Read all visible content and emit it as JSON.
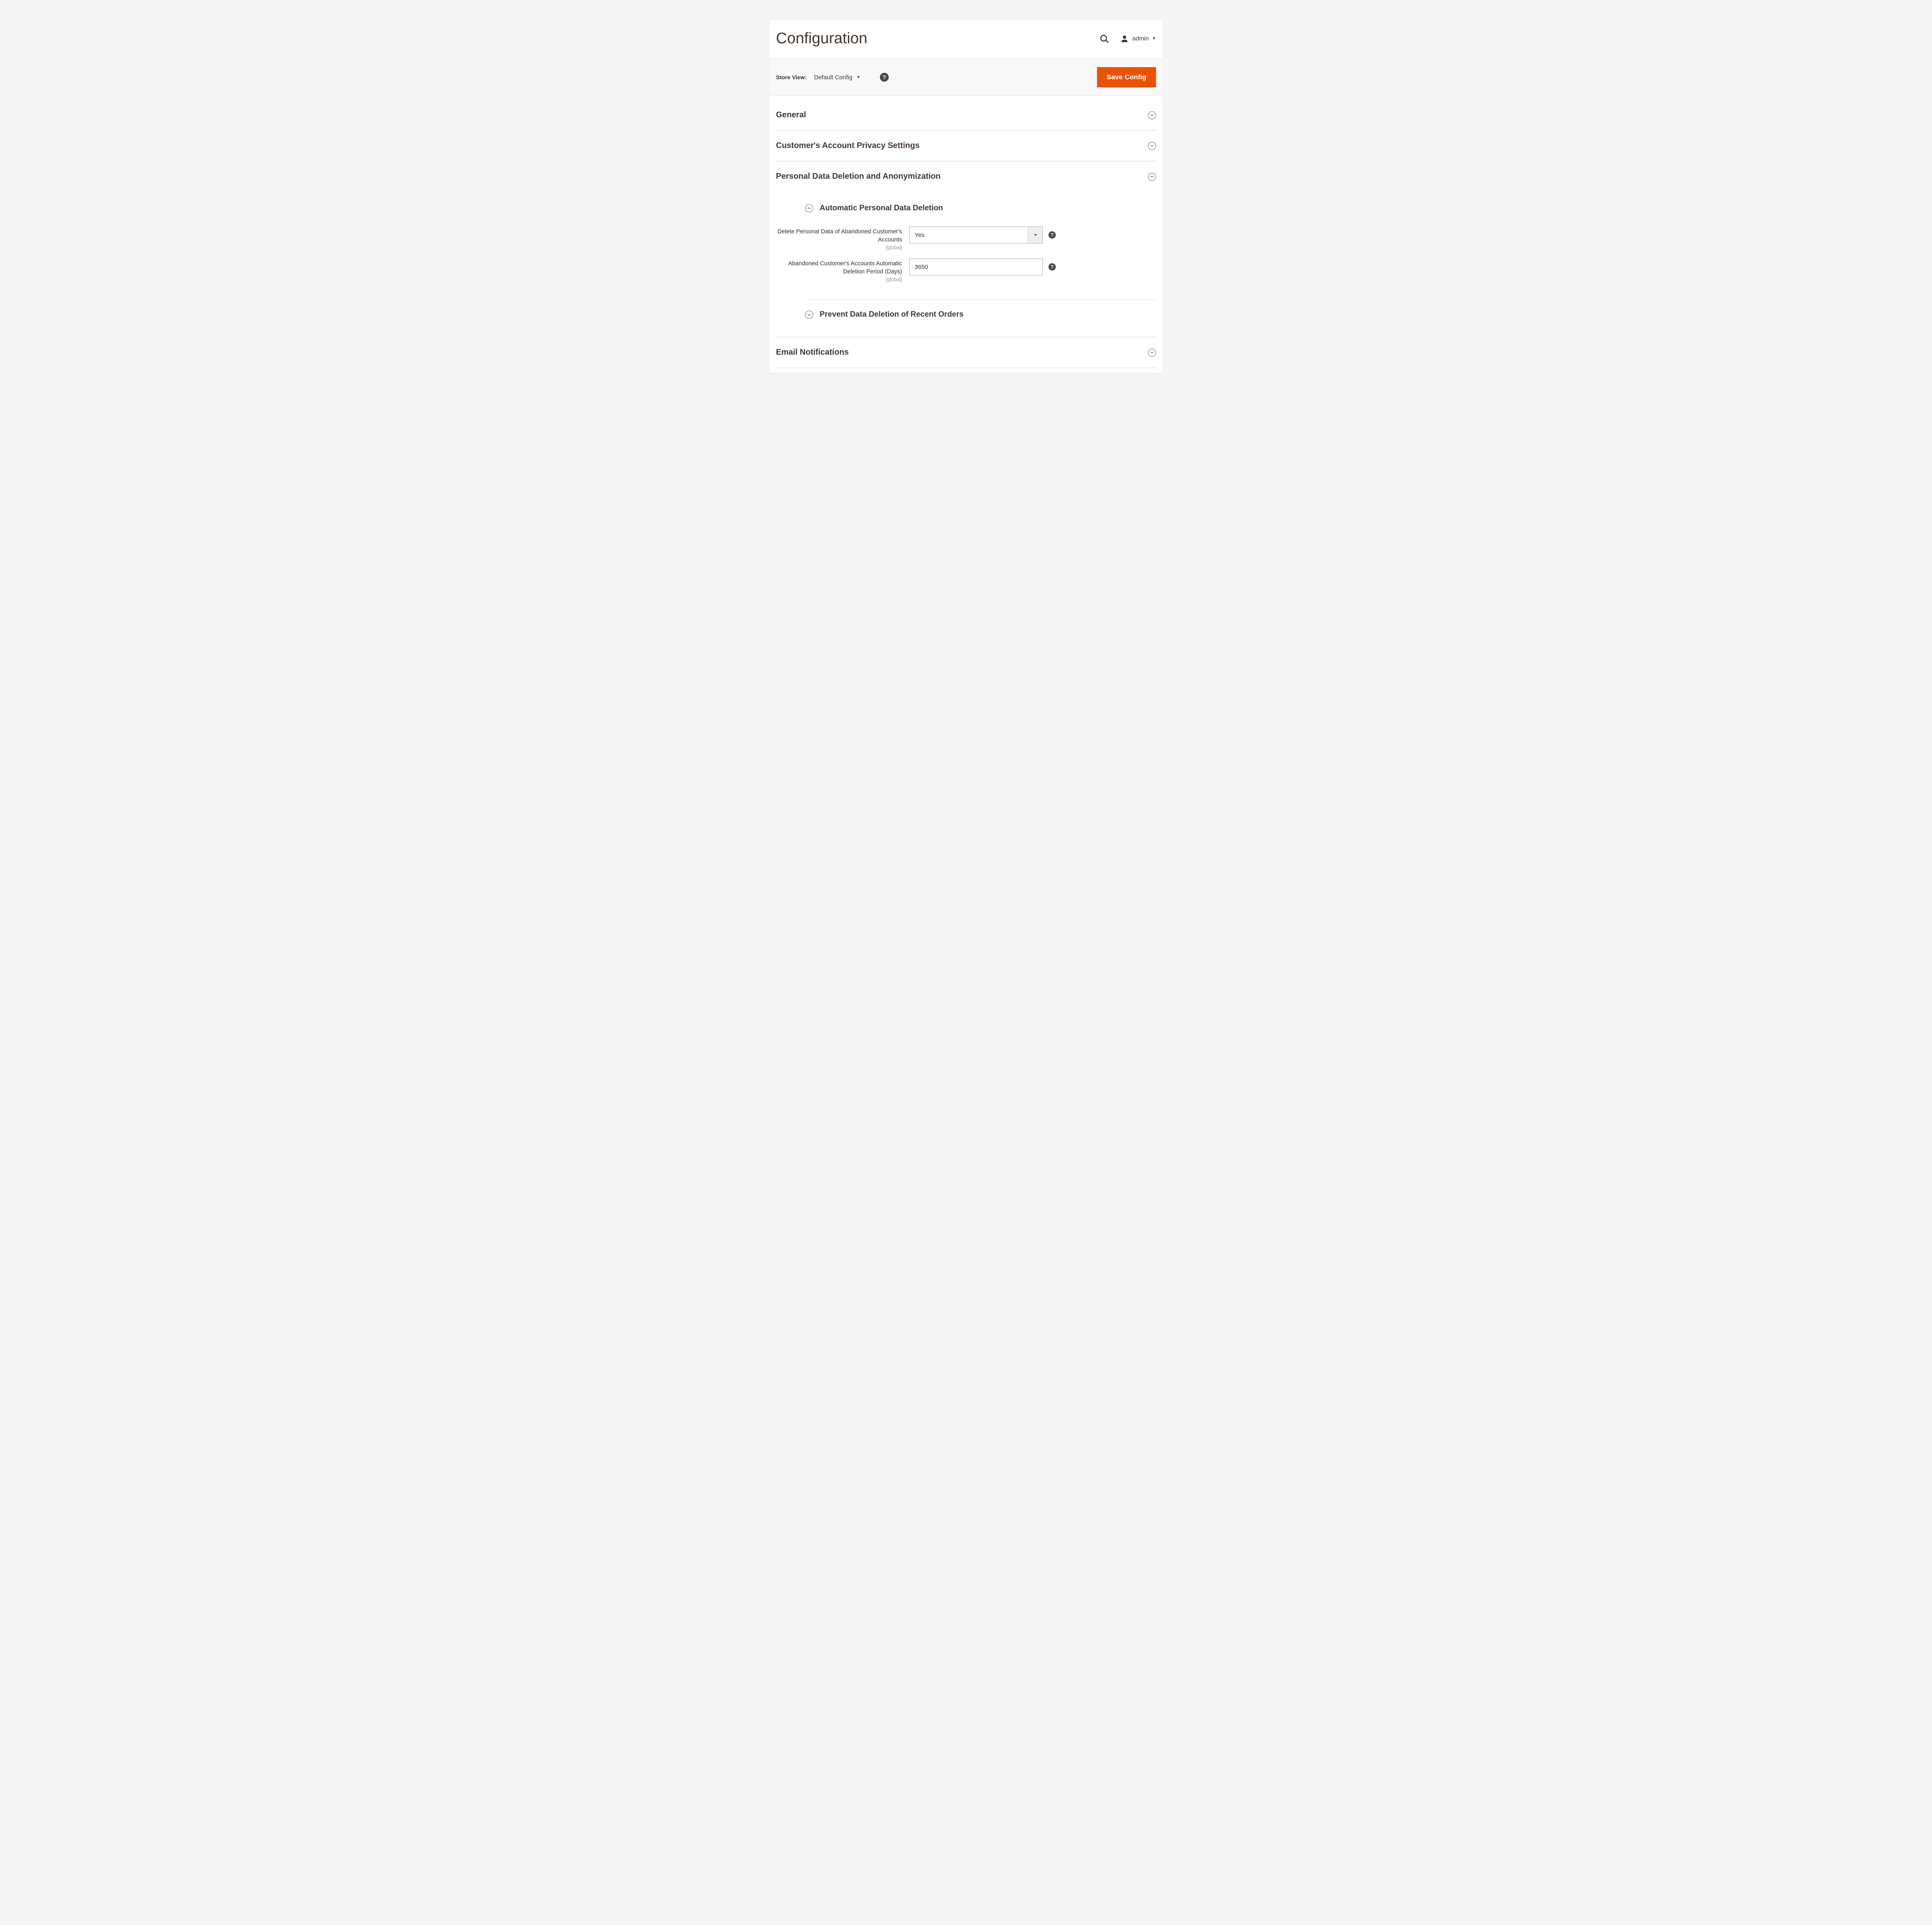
{
  "page": {
    "title": "Configuration"
  },
  "user": {
    "name": "admin"
  },
  "toolbar": {
    "scope_label": "Store View:",
    "scope_value": "Default Config",
    "save_label": "Save Config"
  },
  "sections": {
    "general": {
      "title": "General"
    },
    "privacy": {
      "title": "Customer's Account Privacy Settings"
    },
    "deletion": {
      "title": "Personal Data Deletion and Anonymization",
      "auto": {
        "title": "Automatic Personal Data Deletion",
        "f1": {
          "label": "Delete Personal Data of Abandoned Customer's Accounts",
          "scope": "[global]",
          "value": "Yes"
        },
        "f2": {
          "label": "Abandoned Customer's Accounts Automatic Deletion Period (Days)",
          "scope": "[global]",
          "value": "3650"
        }
      },
      "prevent": {
        "title": "Prevent Data Deletion of Recent Orders"
      }
    },
    "email": {
      "title": "Email Notifications"
    }
  }
}
